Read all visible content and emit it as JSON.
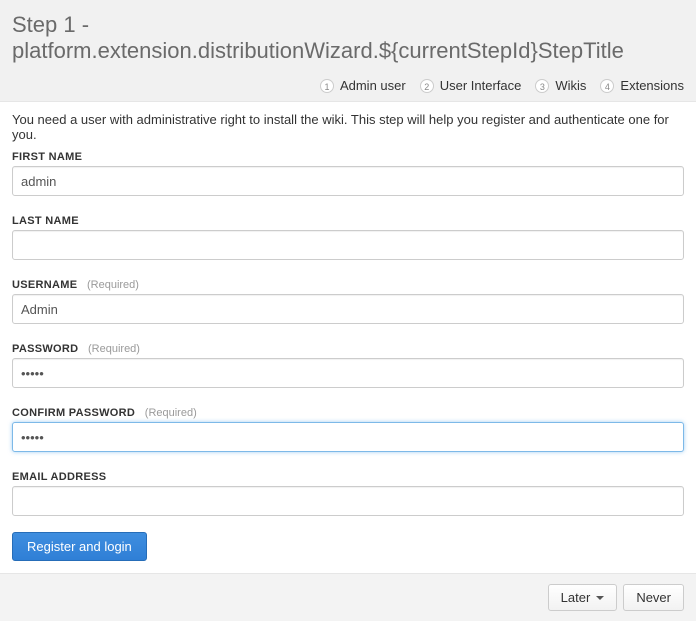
{
  "header": {
    "title": "Step 1 - platform.extension.distributionWizard.${currentStepId}StepTitle"
  },
  "steps": [
    {
      "num": "1",
      "label": "Admin user"
    },
    {
      "num": "2",
      "label": "User Interface"
    },
    {
      "num": "3",
      "label": "Wikis"
    },
    {
      "num": "4",
      "label": "Extensions"
    }
  ],
  "intro": "You need a user with administrative right to install the wiki. This step will help you register and authenticate one for you.",
  "fields": {
    "firstName": {
      "label": "FIRST NAME",
      "value": "admin"
    },
    "lastName": {
      "label": "LAST NAME",
      "value": ""
    },
    "username": {
      "label": "USERNAME",
      "required": "(Required)",
      "value": "Admin"
    },
    "password": {
      "label": "PASSWORD",
      "required": "(Required)",
      "value": "•••••"
    },
    "confirmPassword": {
      "label": "CONFIRM PASSWORD",
      "required": "(Required)",
      "value": "•••••"
    },
    "email": {
      "label": "EMAIL ADDRESS",
      "value": ""
    }
  },
  "buttons": {
    "submit": "Register and login",
    "later": "Later",
    "never": "Never"
  }
}
